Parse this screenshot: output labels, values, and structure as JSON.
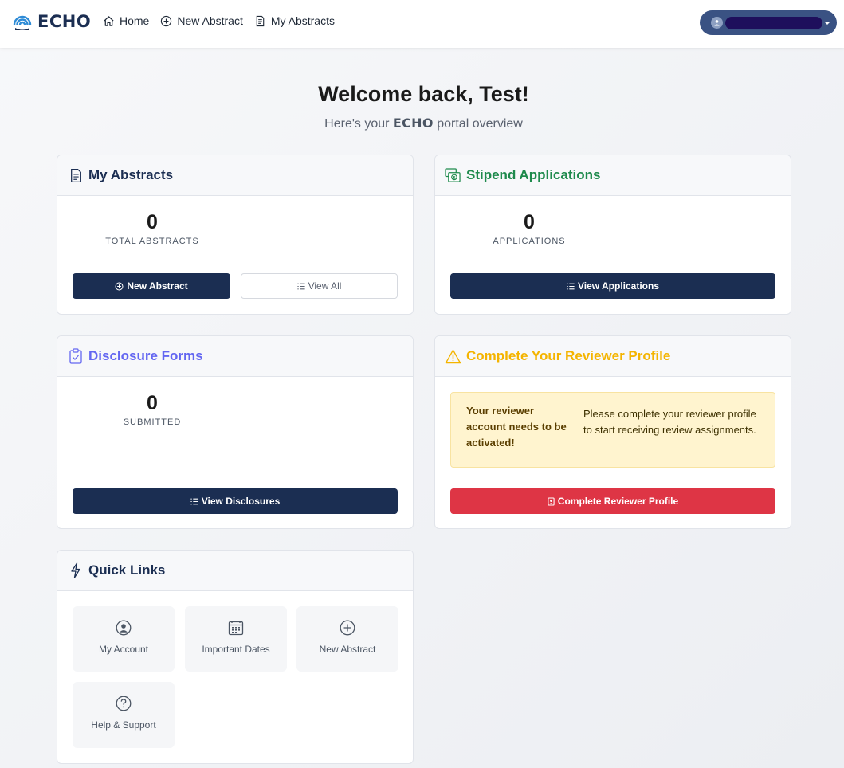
{
  "nav": {
    "brand": "ECHO",
    "links": [
      {
        "label": "Home",
        "icon": "home-icon"
      },
      {
        "label": "New Abstract",
        "icon": "plus-circle-icon"
      },
      {
        "label": "My Abstracts",
        "icon": "file-text-icon"
      }
    ]
  },
  "welcome": {
    "title": "Welcome back, Test!",
    "sub_before": "Here's your ",
    "sub_brand": "ECHO",
    "sub_after": " portal overview"
  },
  "abstracts": {
    "title": "My Abstracts",
    "count": "0",
    "count_label": "TOTAL ABSTRACTS",
    "new_btn": "New Abstract",
    "view_btn": "View All"
  },
  "stipend": {
    "title": "Stipend Applications",
    "count": "0",
    "count_label": "APPLICATIONS",
    "view_btn": "View Applications"
  },
  "disclosure": {
    "title": "Disclosure Forms",
    "count": "0",
    "count_label": "SUBMITTED",
    "view_btn": "View Disclosures"
  },
  "reviewer": {
    "title": "Complete Your Reviewer Profile",
    "alert_strong": "Your reviewer account needs to be activated!",
    "alert_text": "Please complete your reviewer profile to start receiving review assignments.",
    "btn": "Complete Reviewer Profile"
  },
  "quick_links": {
    "title": "Quick Links",
    "items": [
      {
        "label": "My Account",
        "icon": "user-circle-icon"
      },
      {
        "label": "Important Dates",
        "icon": "calendar-icon"
      },
      {
        "label": "New Abstract",
        "icon": "plus-circle-icon"
      },
      {
        "label": "Help & Support",
        "icon": "question-circle-icon"
      }
    ]
  },
  "colors": {
    "navy": "#1b2e52",
    "green": "#1e8a4c",
    "purple": "#6366f1",
    "amber": "#f4b400",
    "danger": "#de3545"
  }
}
